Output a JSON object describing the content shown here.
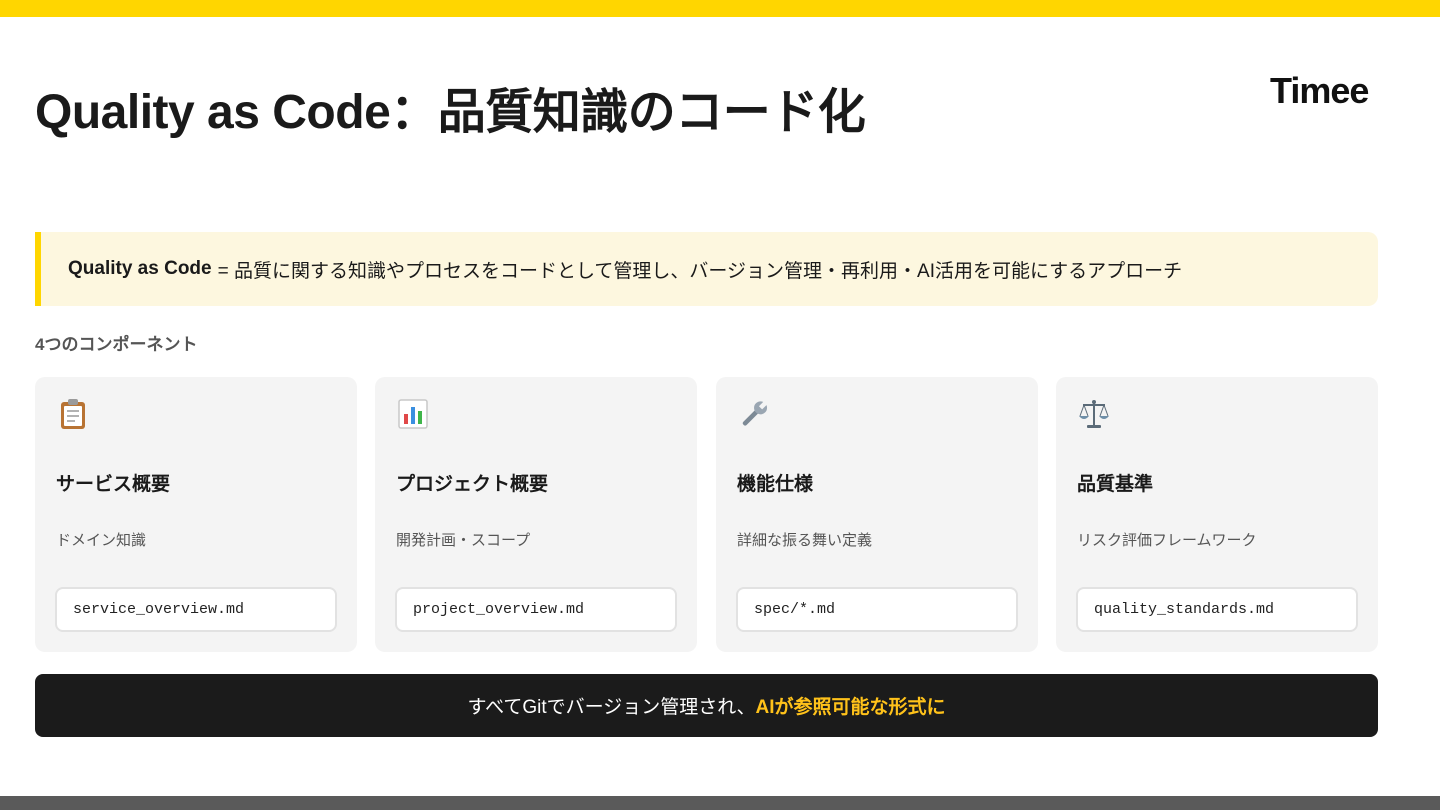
{
  "slide": {
    "title": "Quality as Code：品質知識のコード化",
    "logo": "Timee"
  },
  "definition": {
    "term": "Quality as Code",
    "text": "= 品質に関する知識やプロセスをコードとして管理し、バージョン管理・再利用・AI活用を可能にするアプローチ"
  },
  "section_label": "4つのコンポーネント",
  "components": [
    {
      "icon": "clipboard-icon",
      "title": "サービス概要",
      "description": "ドメイン知識",
      "file": "service_overview.md"
    },
    {
      "icon": "bar-chart-icon",
      "title": "プロジェクト概要",
      "description": "開発計画・スコープ",
      "file": "project_overview.md"
    },
    {
      "icon": "wrench-icon",
      "title": "機能仕様",
      "description": "詳細な振る舞い定義",
      "file": "spec/*.md"
    },
    {
      "icon": "balance-scale-icon",
      "title": "品質基準",
      "description": "リスク評価フレームワーク",
      "file": "quality_standards.md"
    }
  ],
  "banner": {
    "text": "すべてGitでバージョン管理され、",
    "highlight": "AIが参照可能な形式に"
  },
  "colors": {
    "accent_yellow": "#FFD600",
    "highlight_yellow": "#FFC21A",
    "banner_bg": "#1b1b1b",
    "card_bg": "#F4F4F4",
    "definition_bg": "#FDF7DF"
  }
}
